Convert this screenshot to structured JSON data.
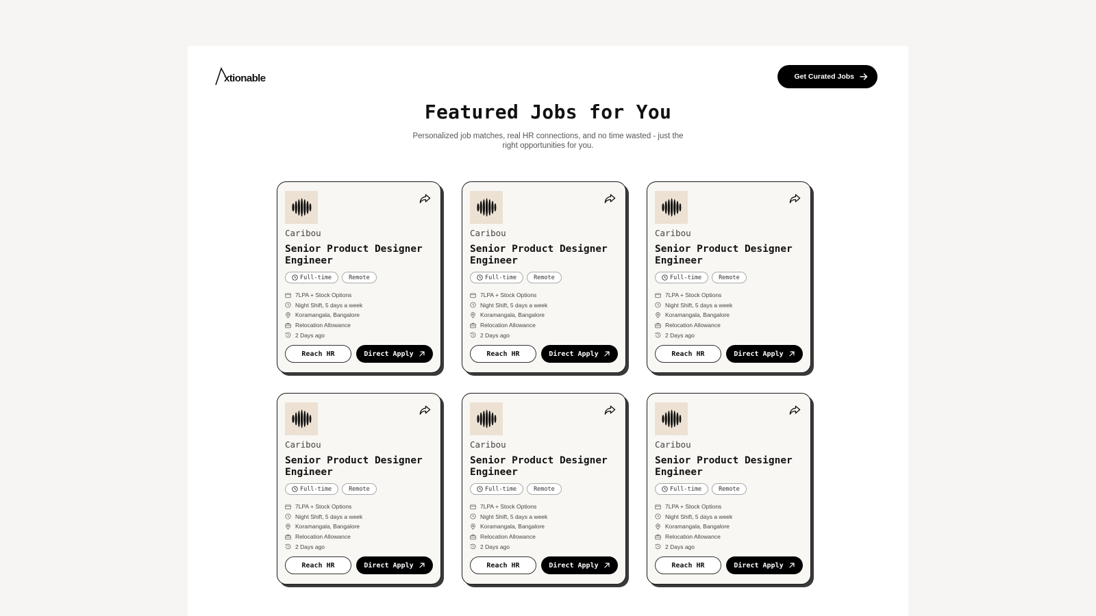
{
  "brand": {
    "logo_text": "xtionable"
  },
  "header": {
    "cta_label": "Get Curated Jobs"
  },
  "hero": {
    "title": "Featured Jobs for You",
    "subtitle": "Personalized job matches, real HR connections, and no time wasted - just the right opportunities for you."
  },
  "colors": {
    "accent": "#000000",
    "card_bg": "#f8f7f3",
    "logo_bg": "#ece1d3"
  },
  "jobs": [
    {
      "company": "Caribou",
      "title": "Senior Product Designer Engineer",
      "tags": [
        "Full-time",
        "Remote"
      ],
      "salary": "7LPA + Stock Options",
      "shift": "Night Shift, 5 days a week",
      "location": "Koramangala, Bangalore",
      "perk": "Relocation Allowance",
      "posted": "2 Days ago",
      "reach_label": "Reach HR",
      "apply_label": "Direct Apply"
    },
    {
      "company": "Caribou",
      "title": "Senior Product Designer Engineer",
      "tags": [
        "Full-time",
        "Remote"
      ],
      "salary": "7LPA + Stock Options",
      "shift": "Night Shift, 5 days a week",
      "location": "Koramangala, Bangalore",
      "perk": "Relocation Allowance",
      "posted": "2 Days ago",
      "reach_label": "Reach HR",
      "apply_label": "Direct Apply"
    },
    {
      "company": "Caribou",
      "title": "Senior Product Designer Engineer",
      "tags": [
        "Full-time",
        "Remote"
      ],
      "salary": "7LPA + Stock Options",
      "shift": "Night Shift, 5 days a week",
      "location": "Koramangala, Bangalore",
      "perk": "Relocation Allowance",
      "posted": "2 Days ago",
      "reach_label": "Reach HR",
      "apply_label": "Direct Apply"
    },
    {
      "company": "Caribou",
      "title": "Senior Product Designer Engineer",
      "tags": [
        "Full-time",
        "Remote"
      ],
      "salary": "7LPA + Stock Options",
      "shift": "Night Shift, 5 days a week",
      "location": "Koramangala, Bangalore",
      "perk": "Relocation Allowance",
      "posted": "2 Days ago",
      "reach_label": "Reach HR",
      "apply_label": "Direct Apply"
    },
    {
      "company": "Caribou",
      "title": "Senior Product Designer Engineer",
      "tags": [
        "Full-time",
        "Remote"
      ],
      "salary": "7LPA + Stock Options",
      "shift": "Night Shift, 5 days a week",
      "location": "Koramangala, Bangalore",
      "perk": "Relocation Allowance",
      "posted": "2 Days ago",
      "reach_label": "Reach HR",
      "apply_label": "Direct Apply"
    },
    {
      "company": "Caribou",
      "title": "Senior Product Designer Engineer",
      "tags": [
        "Full-time",
        "Remote"
      ],
      "salary": "7LPA + Stock Options",
      "shift": "Night Shift, 5 days a week",
      "location": "Koramangala, Bangalore",
      "perk": "Relocation Allowance",
      "posted": "2 Days ago",
      "reach_label": "Reach HR",
      "apply_label": "Direct Apply"
    }
  ]
}
